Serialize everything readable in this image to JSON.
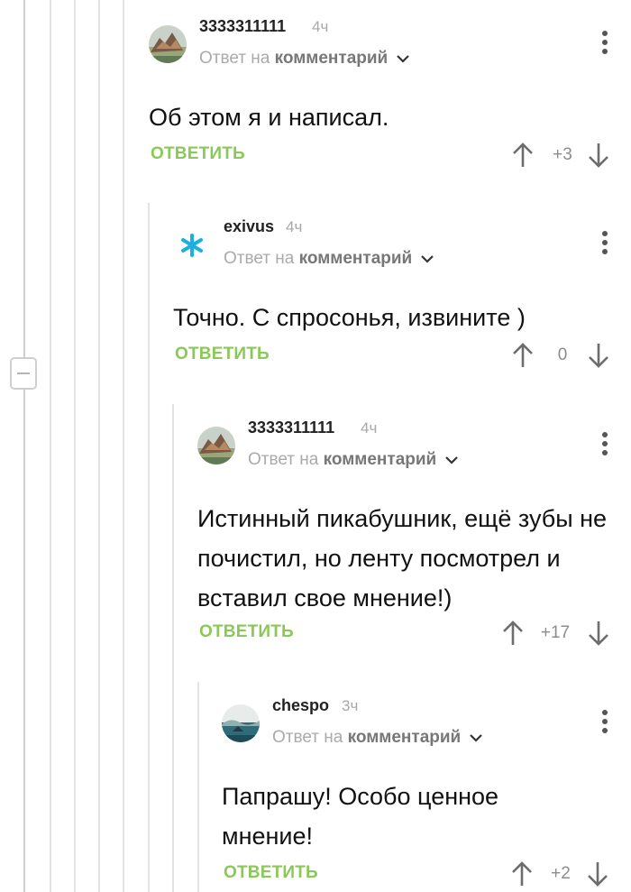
{
  "comments": [
    {
      "author": "3333311111",
      "time": "4ч",
      "reply_prefix": "Ответ на",
      "reply_link": "комментарий",
      "text": "Об этом я и написал.",
      "reply_button": "ОТВЕТИТЬ",
      "score": "+3",
      "avatar": "mountain-landscape-avatar"
    },
    {
      "author": "exivus",
      "time": "4ч",
      "reply_prefix": "Ответ на",
      "reply_link": "комментарий",
      "text": "Точно. С спросонья, извините )",
      "reply_button": "ОТВЕТИТЬ",
      "score": "0",
      "avatar": "asterisk-avatar",
      "avatar_color": "#1ab0e0"
    },
    {
      "author": "3333311111",
      "time": "4ч",
      "reply_prefix": "Ответ на",
      "reply_link": "комментарий",
      "text": "Истинный пикабушник, ещё зубы не почистил, но ленту посмотрел и вставил свое мнение!)",
      "reply_button": "ОТВЕТИТЬ",
      "score": "+17",
      "avatar": "mountain-landscape-avatar"
    },
    {
      "author": "chespo",
      "time": "3ч",
      "reply_prefix": "Ответ на",
      "reply_link": "комментарий",
      "text": "Папрашу! Особо ценное мнение!",
      "reply_button": "ОТВЕТИТЬ",
      "score": "+2",
      "avatar": "sea-landscape-avatar"
    }
  ],
  "colors": {
    "reply_button": "#8ac858",
    "thread_line": "#e3e3e3",
    "muted_text": "#aaaaaa"
  }
}
